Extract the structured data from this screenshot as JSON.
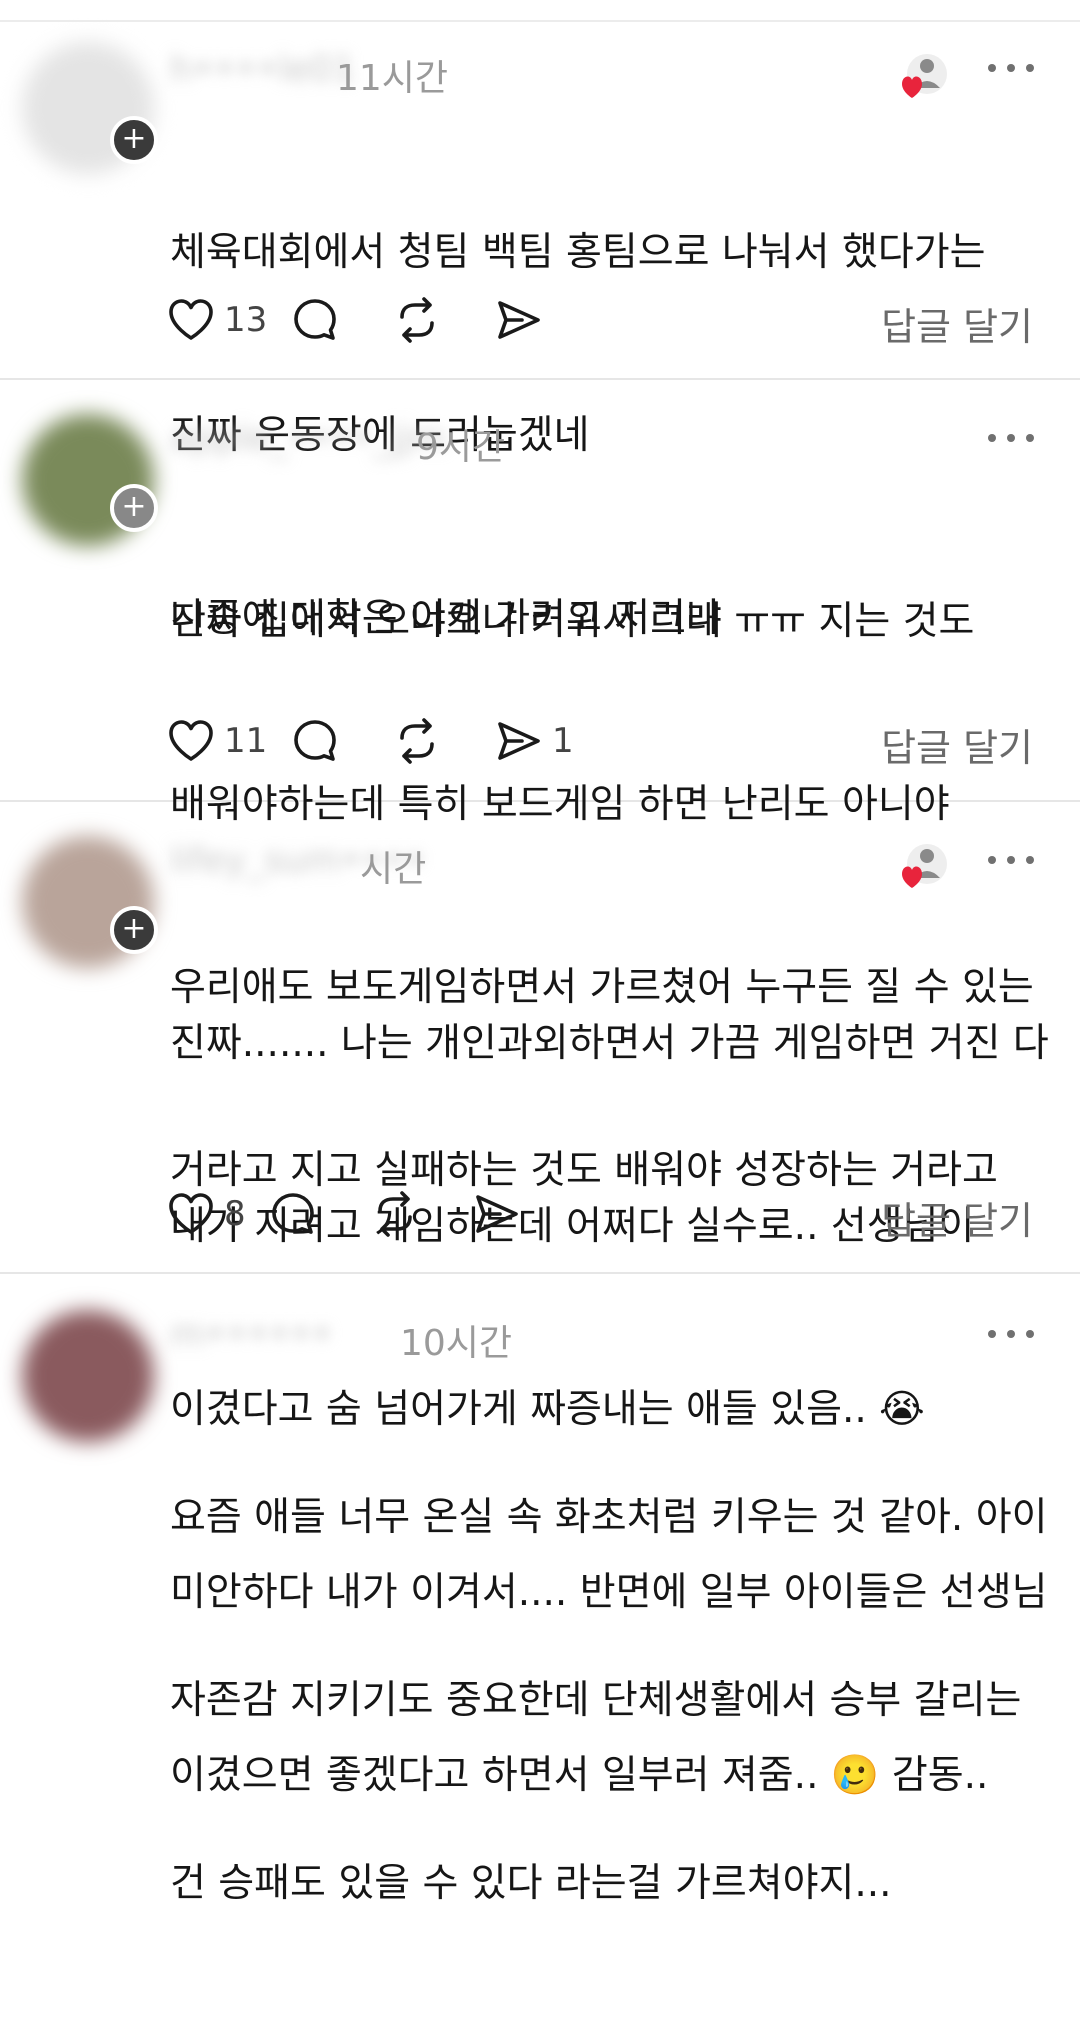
{
  "posts": [
    {
      "username": "h••••le01",
      "time": "11시간",
      "has_follow_badge": true,
      "liked_by_author": true,
      "lines": [
        "체육대회에서 청팀 백팀 홍팀으로 나눠서 했다가는",
        "진짜 운동장에 드러눕겠네",
        "나중에 대학은 어케 가려고 저러냐"
      ],
      "likes": "13",
      "comments": "",
      "reposts": "",
      "shares": "",
      "reply_label": "답글 달기"
    },
    {
      "username": "apple_••••_jjm",
      "time": "9시간",
      "has_follow_badge": true,
      "liked_by_author": false,
      "lines": [
        "진짜 집에서 오냐오냐 키워서 그래 ㅠㅠ 지는 것도",
        "배워야하는데 특히 보드게임 하면 난리도 아니야",
        "우리애도 보도게임하면서 가르쳤어 누구든 질 수 있는",
        "거라고 지고 실패하는 것도 배워야 성장하는 거라고"
      ],
      "likes": "11",
      "comments": "",
      "reposts": "",
      "shares": "1",
      "reply_label": "답글 달기"
    },
    {
      "username": "lifey_sum••••",
      "time": "시간",
      "has_follow_badge": true,
      "liked_by_author": true,
      "lines": [
        "진짜....... 나는 개인과외하면서 가끔 게임하면 거진 다",
        "내가 지려고 게임하는데 어쩌다 실수로.. 선생님이",
        "이겼다고 숨 넘어가게 짜증내는 애들 있음.. 😭",
        "미안하다 내가 이겨서.... 반면에 일부 아이들은 선생님",
        "이겼으면 좋겠다고 하면서 일부러 져줌.. 🥲 감동.."
      ],
      "likes": "8",
      "comments": "",
      "reposts": "",
      "shares": "",
      "reply_label": "답글 달기"
    },
    {
      "username": "m••••••",
      "time": "10시간",
      "has_follow_badge": false,
      "liked_by_author": false,
      "lines": [
        "요즘 애들 너무 온실 속 화초처럼 키우는 것 같아. 아이",
        "자존감 지키기도 중요한데 단체생활에서 승부 갈리는",
        "건 승패도 있을 수 있다 라는걸 가르쳐야지..."
      ],
      "likes": "",
      "comments": "",
      "reposts": "",
      "shares": "",
      "reply_label": ""
    }
  ],
  "colors": {
    "heart": "#e8243c",
    "icon": "#1a1a1a",
    "muted_text": "#6a6a6a"
  },
  "icons": [
    "heart-icon",
    "comment-icon",
    "repost-icon",
    "share-icon",
    "more-icon",
    "plus-icon",
    "person-icon"
  ]
}
